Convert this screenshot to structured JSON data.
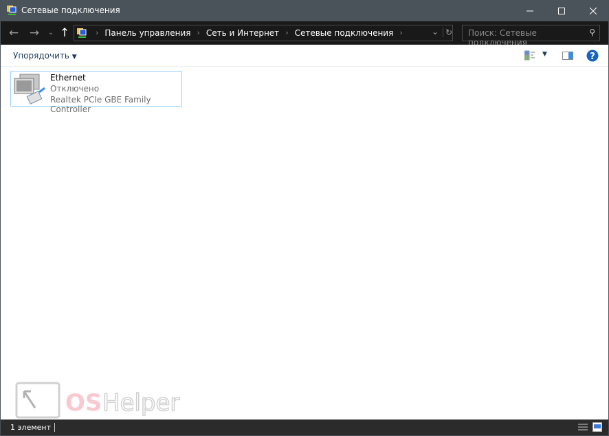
{
  "window": {
    "title": "Сетевые подключения"
  },
  "nav": {
    "breadcrumbs": [
      "Панель управления",
      "Сеть и Интернет",
      "Сетевые подключения"
    ],
    "search_placeholder": "Поиск: Сетевые подключения"
  },
  "toolbar": {
    "sort_label": "Упорядочить"
  },
  "items": [
    {
      "name": "Ethernet",
      "status": "Отключено",
      "device": "Realtek PCIe GBE Family Controller"
    }
  ],
  "statusbar": {
    "count": "1 элемент"
  },
  "watermark": "OS Helper"
}
